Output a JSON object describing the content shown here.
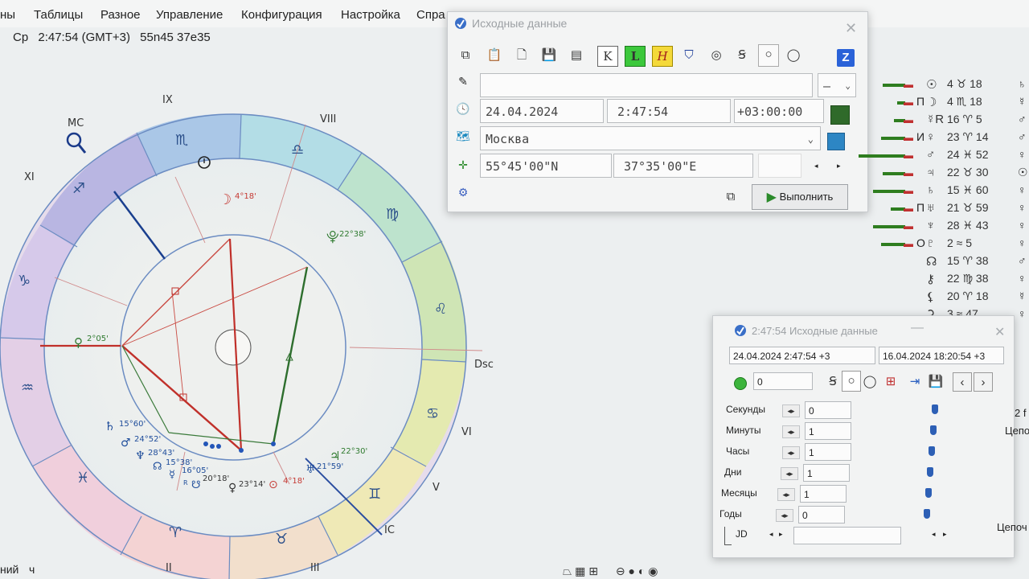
{
  "menu": {
    "items": [
      "ны",
      "Таблицы",
      "Разное",
      "Управление",
      "Конфигурация",
      "Настройка",
      "Спра"
    ]
  },
  "info": {
    "weekday": "Ср",
    "time": "2:47:54 (GMT+3)",
    "coords": "55n45  37e35"
  },
  "chart": {
    "house_labels": {
      "ix": "IX",
      "viii": "VIII",
      "xi": "XI",
      "vi": "VI",
      "v": "V",
      "ic": "IC",
      "ii": "II",
      "iii": "III"
    },
    "mc": "MC",
    "dsc": "Dsc",
    "planets": {
      "moon": "4°18'",
      "pluto": "22°38'",
      "venus": "2°05'",
      "saturn": "15°60'",
      "mars": "24°52'",
      "neptune": "28°43'",
      "uranus": "15°38'",
      "mercury": "16°05'",
      "mercury_r": "R",
      "node": "20°18'",
      "jupiter": "22°30'",
      "chiron": "21°59'",
      "venus2": "23°14'",
      "sun": "4°18'"
    }
  },
  "dialog_main": {
    "title": "Исходные данные",
    "date": "24.04.2024",
    "time": "2:47:54",
    "tz": "+03:00:00",
    "place": "Москва",
    "lat": "55°45'00\"N",
    "lon": "37°35'00\"E",
    "name": "",
    "dash": "–",
    "run": "Выполнить",
    "toolbar": {
      "k": "K",
      "l": "L",
      "h": "H",
      "z": "Z"
    }
  },
  "dialog_time": {
    "title": "2:47:54 Исходные данные",
    "datetime": "24.04.2024   2:47:54  +3",
    "datetime2": "16.04.2024   18:20:54  +3",
    "counter": "0",
    "rows": [
      {
        "label": "Секунды",
        "value": "0"
      },
      {
        "label": "Минуты",
        "value": "1"
      },
      {
        "label": "Часы",
        "value": "1"
      },
      {
        "label": "Дни",
        "value": "1"
      },
      {
        "label": "Месяцы",
        "value": "1"
      },
      {
        "label": "Годы",
        "value": "0"
      }
    ],
    "jd": "JD"
  },
  "right_list": [
    {
      "aspect": "",
      "planet": "☉",
      "pos": "4 ♉ 18",
      "asp2": "♄"
    },
    {
      "aspect": "П",
      "planet": "☽",
      "pos": "4 ♏ 18",
      "asp2": "☿"
    },
    {
      "aspect": "",
      "planet": "☿R",
      "pos": "16 ♈ 5",
      "asp2": "♂"
    },
    {
      "aspect": "И",
      "planet": "♀",
      "pos": "23 ♈ 14",
      "asp2": "♂"
    },
    {
      "aspect": "",
      "planet": "♂",
      "pos": "24 ♓ 52",
      "asp2": "♀"
    },
    {
      "aspect": "",
      "planet": "♃",
      "pos": "22 ♉ 30",
      "asp2": "☉"
    },
    {
      "aspect": "",
      "planet": "♄",
      "pos": "15 ♓ 60",
      "asp2": "♀"
    },
    {
      "aspect": "П",
      "planet": "♅",
      "pos": "21 ♉ 59",
      "asp2": "♀"
    },
    {
      "aspect": "",
      "planet": "♆",
      "pos": "28 ♓ 43",
      "asp2": "♀"
    },
    {
      "aspect": "О",
      "planet": "♇",
      "pos": "2 ≈ 5",
      "asp2": "♀"
    },
    {
      "aspect": "",
      "planet": "☊",
      "pos": "15 ♈ 38",
      "asp2": "♂"
    },
    {
      "aspect": "",
      "planet": "⚷",
      "pos": "22 ♍ 38",
      "asp2": "♀"
    },
    {
      "aspect": "",
      "planet": "⚸",
      "pos": "20 ♈ 18",
      "asp2": "☿"
    },
    {
      "aspect": "",
      "planet": "⚳",
      "pos": "3 ≈ 47",
      "asp2": "♀"
    }
  ],
  "right_edge": {
    "a": "2 f",
    "b": "Цепо",
    "c": "Цепоч"
  },
  "bottom_left": {
    "a": "ний",
    "b": "ч"
  }
}
